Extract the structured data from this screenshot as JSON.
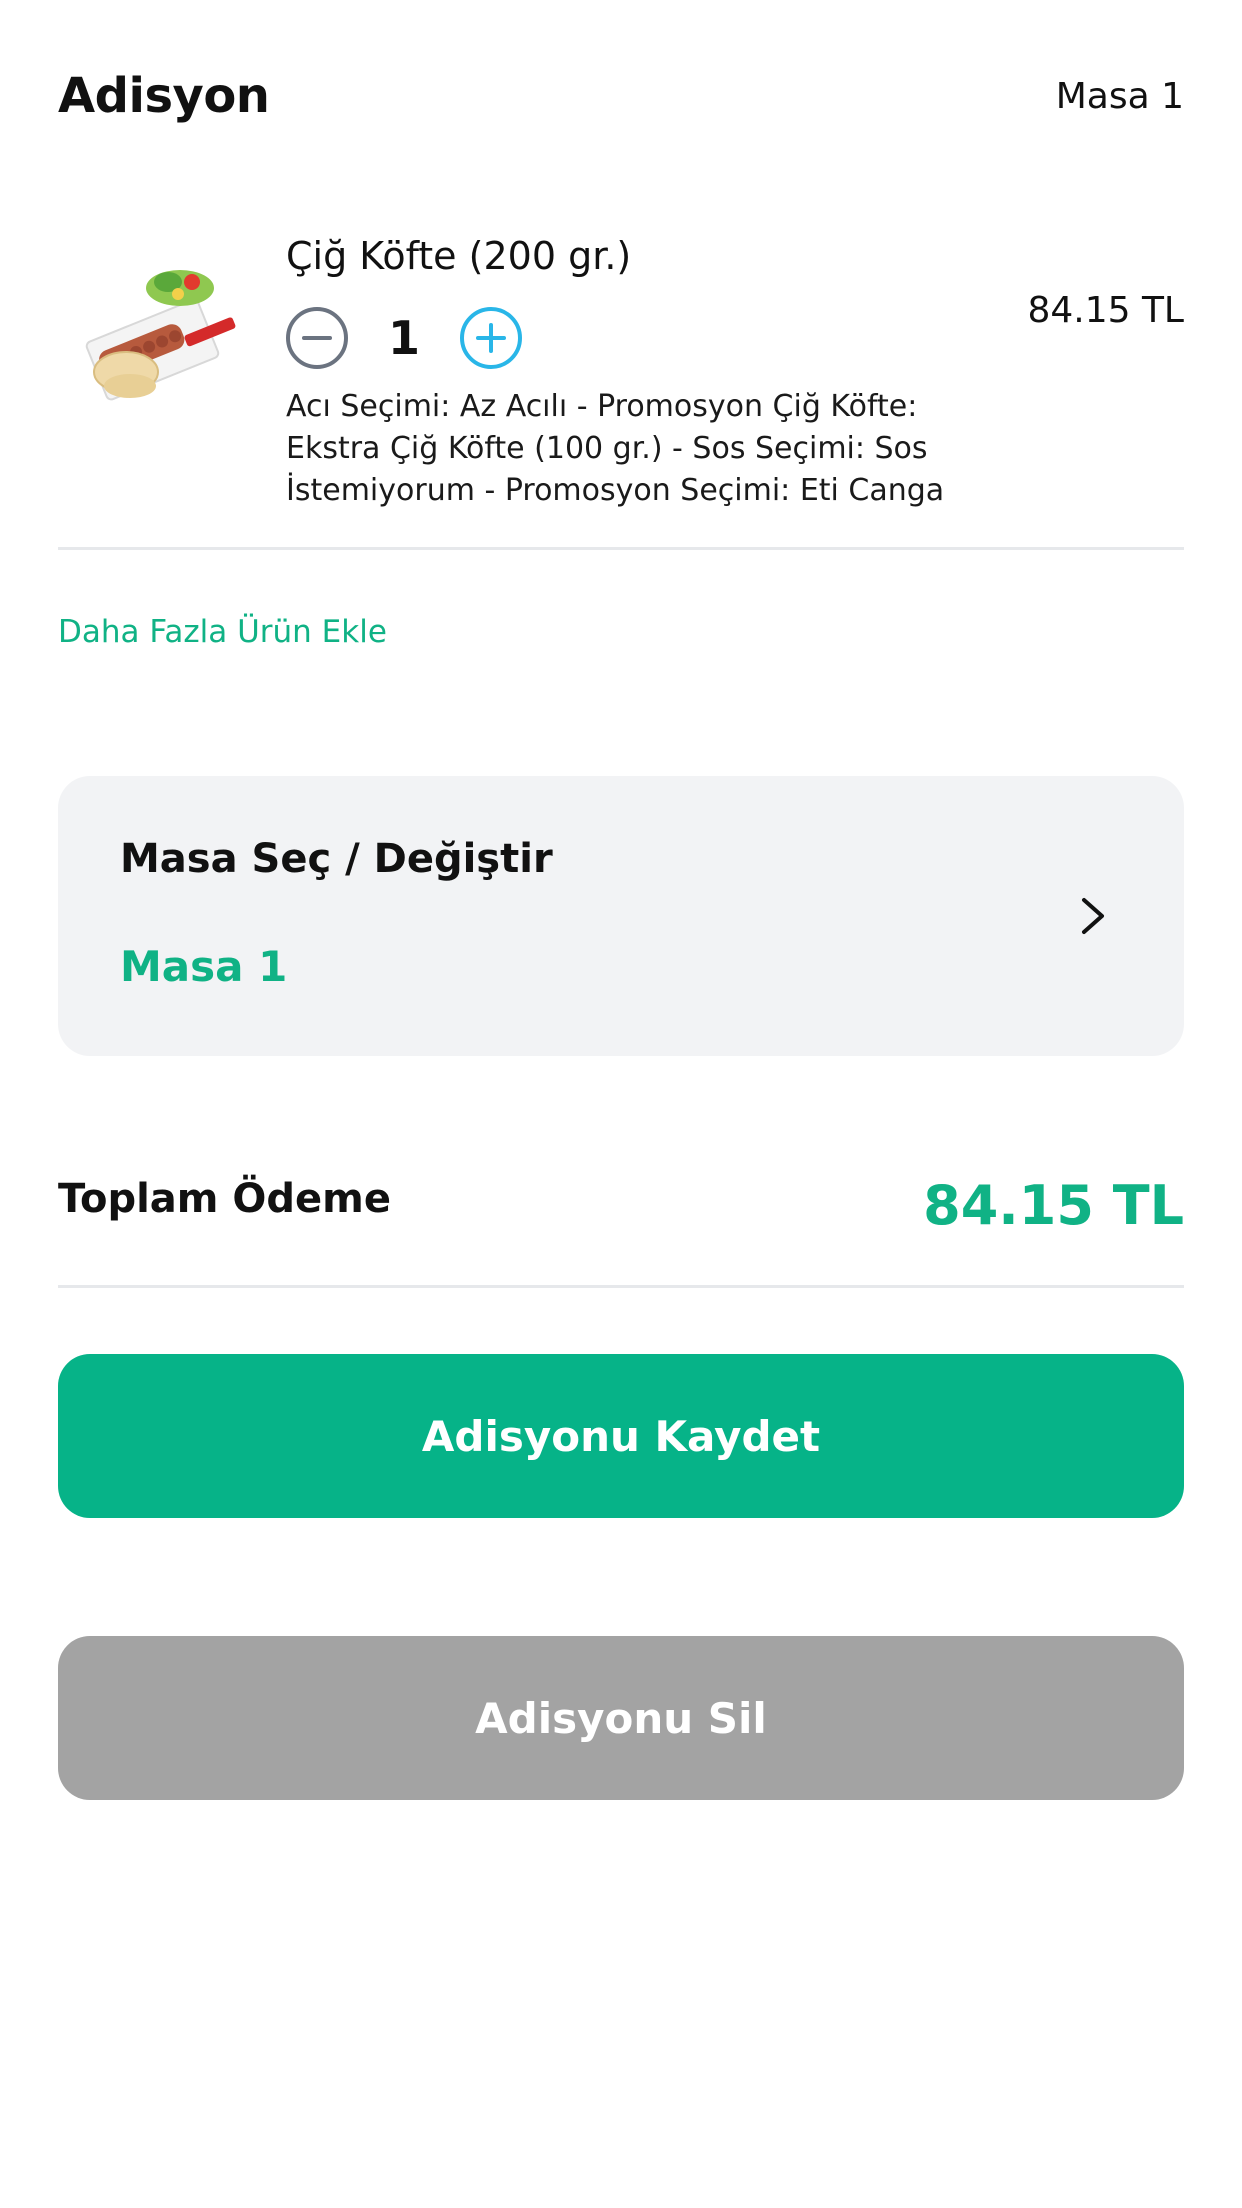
{
  "header": {
    "title": "Adisyon",
    "table": "Masa 1"
  },
  "order": {
    "items": [
      {
        "name": "Çiğ Köfte (200 gr.)",
        "quantity": "1",
        "price": "84.15 TL",
        "options": "Acı Seçimi: Az Acılı - Promosyon Çiğ Köfte: Ekstra Çiğ Köfte (100 gr.) - Sos Seçimi: Sos İstemiyorum - Promosyon Seçimi: Eti Canga",
        "image_icon": "cig-kofte-plate-image",
        "decrement_icon": "minus-circle-icon",
        "increment_icon": "plus-circle-icon"
      }
    ],
    "add_more_label": "Daha Fazla Ürün Ekle"
  },
  "table_selector": {
    "title": "Masa Seç / Değiştir",
    "selected": "Masa 1",
    "icon": "chevron-right-icon"
  },
  "total": {
    "label": "Toplam Ödeme",
    "value": "84.15 TL"
  },
  "actions": {
    "save_label": "Adisyonu Kaydet",
    "delete_label": "Adisyonu Sil"
  },
  "colors": {
    "accent": "#10b285",
    "primary_button": "#06b388",
    "disabled_button": "#a3a3a3",
    "increment": "#29b6e8",
    "decrement": "#6b7380"
  }
}
